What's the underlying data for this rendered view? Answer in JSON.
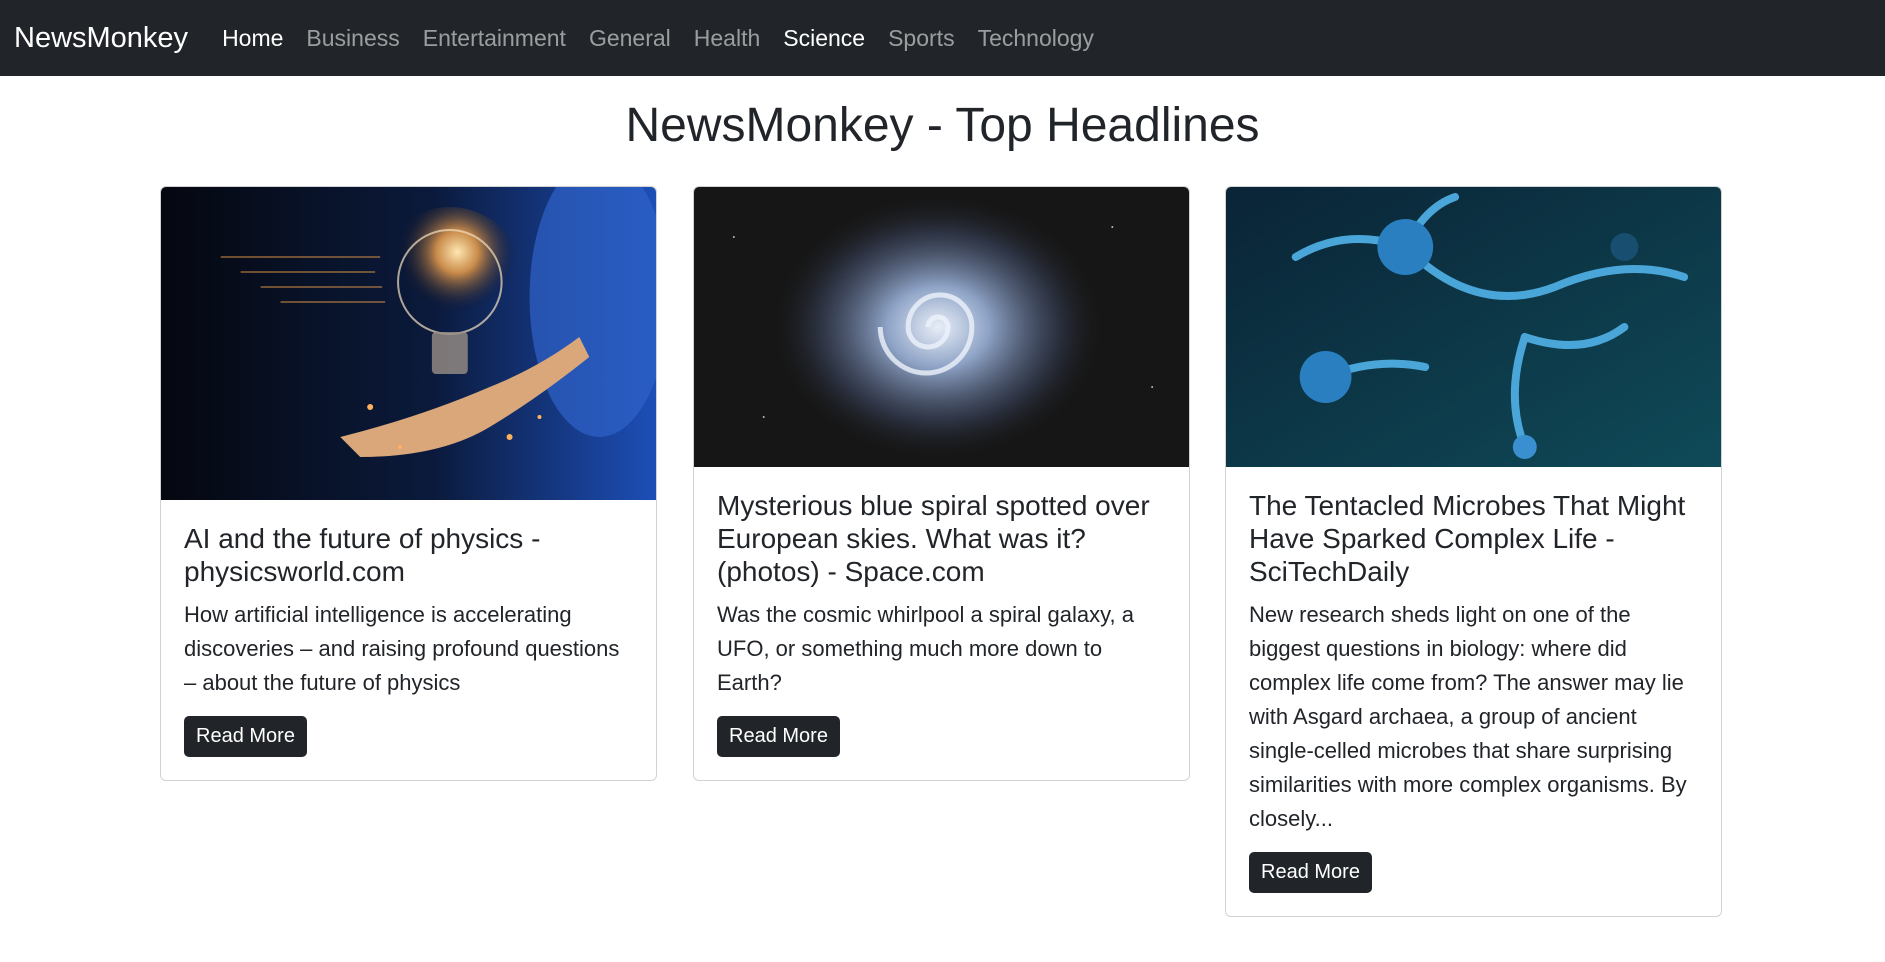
{
  "navbar": {
    "brand": "NewsMonkey",
    "links": [
      {
        "label": "Home"
      },
      {
        "label": "Business"
      },
      {
        "label": "Entertainment"
      },
      {
        "label": "General"
      },
      {
        "label": "Health"
      },
      {
        "label": "Science"
      },
      {
        "label": "Sports"
      },
      {
        "label": "Technology"
      }
    ]
  },
  "page": {
    "title": "NewsMonkey - Top Headlines"
  },
  "articles": [
    {
      "image": "lightbulb-ai-hand-image",
      "title": "AI and the future of physics - physicsworld.com",
      "description": "How artificial intelligence is accelerating discoveries – and raising profound questions – about the future of physics",
      "button": "Read More"
    },
    {
      "image": "blue-spiral-sky-image",
      "title": "Mysterious blue spiral spotted over European skies. What was it? (photos) - Space.com",
      "description": "Was the cosmic whirlpool a spiral galaxy, a UFO, or something much more down to Earth?",
      "button": "Read More"
    },
    {
      "image": "tentacled-microbes-image",
      "title": "The Tentacled Microbes That Might Have Sparked Complex Life - SciTechDaily",
      "description": "New research sheds light on one of the biggest questions in biology: where did complex life come from? The answer may lie with Asgard archaea, a group of ancient single-celled microbes that share surprising similarities with more complex organisms. By closely...",
      "button": "Read More"
    }
  ],
  "colors": {
    "navbar_bg": "#212529",
    "button_bg": "#212529",
    "text": "#212529"
  }
}
